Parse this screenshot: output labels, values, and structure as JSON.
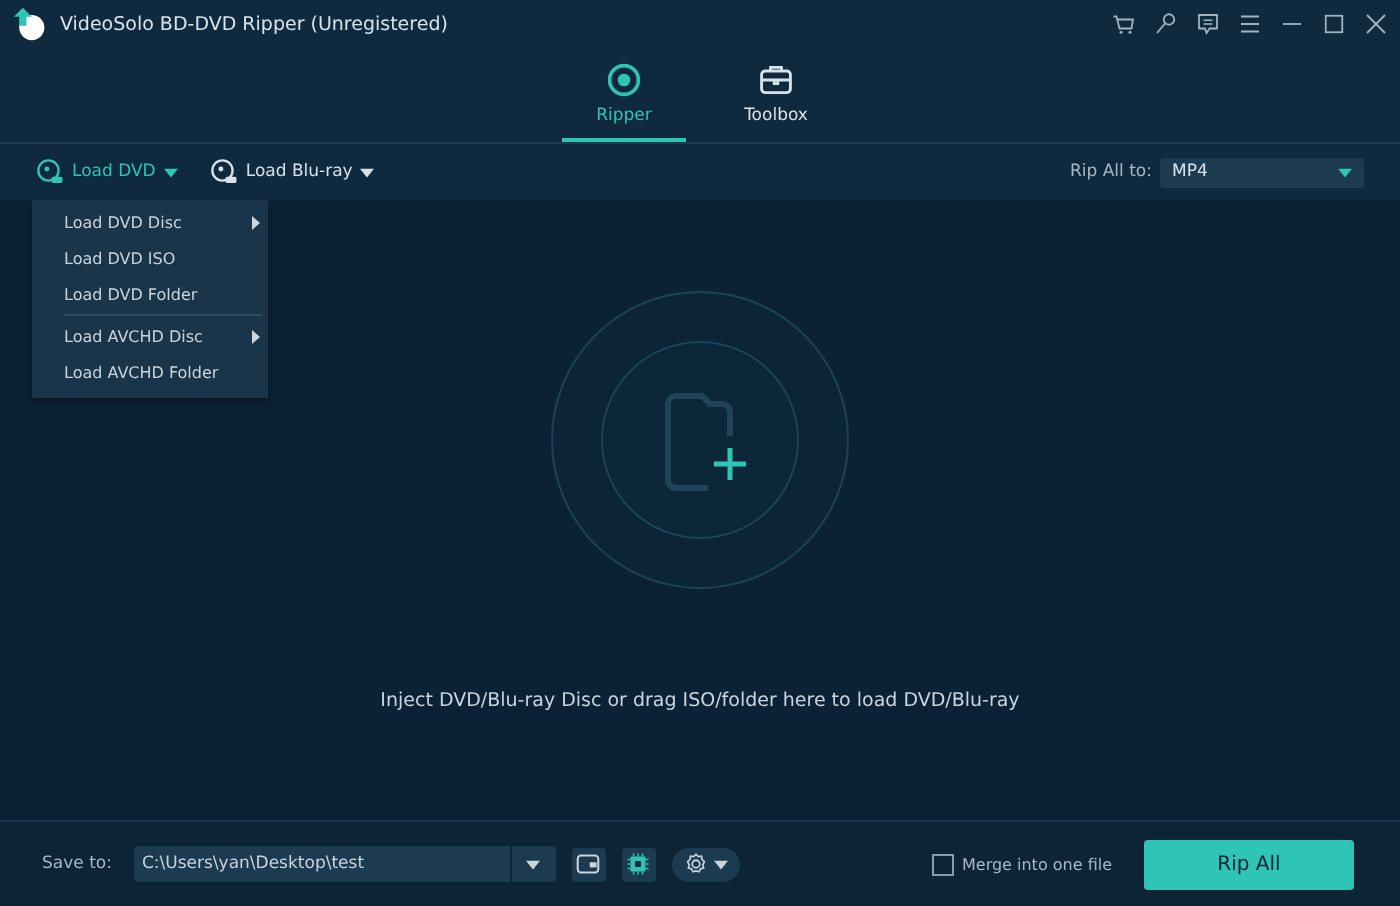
{
  "window": {
    "title": "VideoSolo BD-DVD Ripper (Unregistered)"
  },
  "tabs": [
    {
      "label": "Ripper",
      "selected": true
    },
    {
      "label": "Toolbox",
      "selected": false
    }
  ],
  "toolbar": {
    "loaders": [
      {
        "label": "Load DVD",
        "selected": true
      },
      {
        "label": "Load Blu-ray",
        "selected": false
      }
    ],
    "rip_all_label": "Rip All to:",
    "format": "MP4"
  },
  "menu": {
    "sections": [
      [
        {
          "label": "Load DVD Disc",
          "submenu": true
        },
        {
          "label": "Load DVD ISO",
          "submenu": false
        },
        {
          "label": "Load DVD Folder",
          "submenu": false
        }
      ],
      [
        {
          "label": "Load AVCHD Disc",
          "submenu": true
        },
        {
          "label": "Load AVCHD Folder",
          "submenu": false
        }
      ]
    ]
  },
  "drop_hint": "Inject DVD/Blu-ray Disc or drag ISO/folder here to load DVD/Blu-ray",
  "bottom": {
    "save_label": "Save to:",
    "path": "C:\\Users\\yan\\Desktop\\test",
    "merge": {
      "label": "Merge into one file",
      "checked": false
    },
    "rip_button": "Rip All"
  }
}
